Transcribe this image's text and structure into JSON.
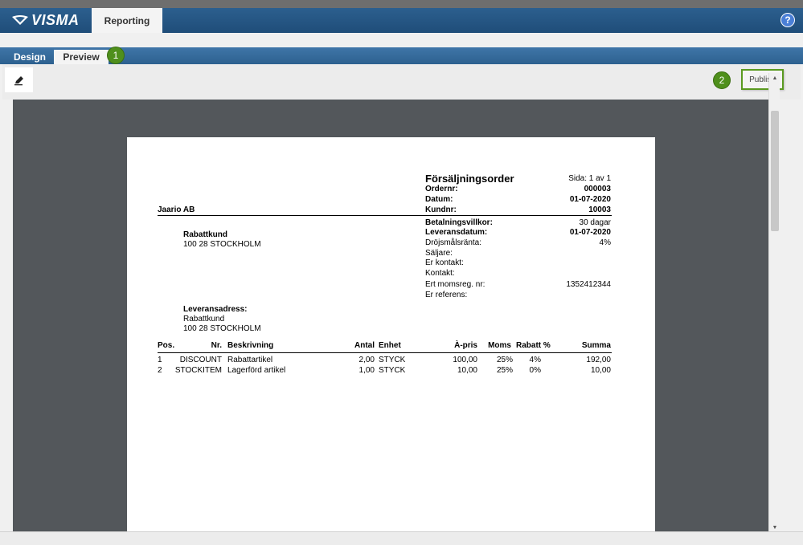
{
  "header": {
    "logo_text": "VISMA",
    "module_tab": "Reporting",
    "help_icon": "?"
  },
  "tabs": [
    {
      "label": "Design"
    },
    {
      "label": "Preview"
    }
  ],
  "badges": {
    "one": "1",
    "two": "2"
  },
  "toolbar": {
    "publish_label": "Publish"
  },
  "document": {
    "title": "Försäljningsorder",
    "page_label": "Sida: 1 av 1",
    "company": "Jaario AB",
    "fields_top": [
      {
        "label": "Ordernr:",
        "value": "000003"
      },
      {
        "label": "Datum:",
        "value": "01-07-2020"
      },
      {
        "label": "Kundnr:",
        "value": "10003"
      }
    ],
    "fields_mid": [
      {
        "label": "Betalningsvillkor:",
        "value": "30 dagar"
      },
      {
        "label": "Leveransdatum:",
        "value": "01-07-2020"
      },
      {
        "label": "Dröjsmålsränta:",
        "value": "4%"
      },
      {
        "label": "Säljare:",
        "value": ""
      },
      {
        "label": "Er kontakt:",
        "value": ""
      },
      {
        "label": "Kontakt:",
        "value": ""
      },
      {
        "label": "Ert momsreg. nr:",
        "value": "1352412344"
      },
      {
        "label": "Er referens:",
        "value": ""
      }
    ],
    "customer": {
      "name": "Rabattkund",
      "postal": "100 28 STOCKHOLM"
    },
    "delivery": {
      "heading": "Leveransadress:",
      "name": "Rabattkund",
      "postal": "100 28 STOCKHOLM"
    },
    "table": {
      "headers": [
        "Pos.",
        "Nr.",
        "Beskrivning",
        "Antal",
        "Enhet",
        "À-pris",
        "Moms",
        "Rabatt %",
        "Summa"
      ],
      "rows": [
        [
          "1",
          "DISCOUNT",
          "Rabattartikel",
          "2,00",
          "STYCK",
          "100,00",
          "25%",
          "4%",
          "192,00"
        ],
        [
          "2",
          "STOCKITEM",
          "Lagerförd artikel",
          "1,00",
          "STYCK",
          "10,00",
          "25%",
          "0%",
          "10,00"
        ]
      ]
    }
  }
}
